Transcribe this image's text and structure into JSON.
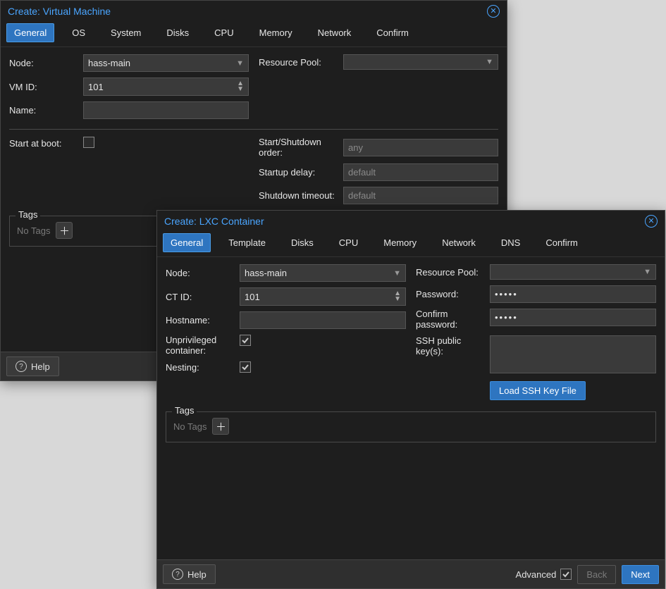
{
  "vm": {
    "title": "Create: Virtual Machine",
    "tabs": [
      "General",
      "OS",
      "System",
      "Disks",
      "CPU",
      "Memory",
      "Network",
      "Confirm"
    ],
    "active_tab": 0,
    "labels": {
      "node": "Node:",
      "vmid": "VM ID:",
      "name": "Name:",
      "resource_pool": "Resource Pool:",
      "start_at_boot": "Start at boot:",
      "start_shutdown_order": "Start/Shutdown order:",
      "startup_delay": "Startup delay:",
      "shutdown_timeout": "Shutdown timeout:",
      "tags_legend": "Tags",
      "no_tags": "No Tags",
      "help": "Help"
    },
    "values": {
      "node": "hass-main",
      "vmid": "101",
      "name": "",
      "resource_pool": "",
      "start_at_boot": false
    },
    "placeholders": {
      "order": "any",
      "startup_delay": "default",
      "shutdown_timeout": "default"
    }
  },
  "lxc": {
    "title": "Create: LXC Container",
    "tabs": [
      "General",
      "Template",
      "Disks",
      "CPU",
      "Memory",
      "Network",
      "DNS",
      "Confirm"
    ],
    "active_tab": 0,
    "labels": {
      "node": "Node:",
      "ctid": "CT ID:",
      "hostname": "Hostname:",
      "unprivileged": "Unprivileged container:",
      "nesting": "Nesting:",
      "resource_pool": "Resource Pool:",
      "password": "Password:",
      "confirm_password": "Confirm password:",
      "ssh_keys": "SSH public key(s):",
      "load_ssh": "Load SSH Key File",
      "tags_legend": "Tags",
      "no_tags": "No Tags",
      "help": "Help",
      "advanced": "Advanced",
      "back": "Back",
      "next": "Next"
    },
    "values": {
      "node": "hass-main",
      "ctid": "101",
      "hostname": "",
      "unprivileged": true,
      "nesting": true,
      "resource_pool": "",
      "password": "•••••",
      "confirm_password": "•••••",
      "ssh_keys": "",
      "advanced": true
    }
  }
}
